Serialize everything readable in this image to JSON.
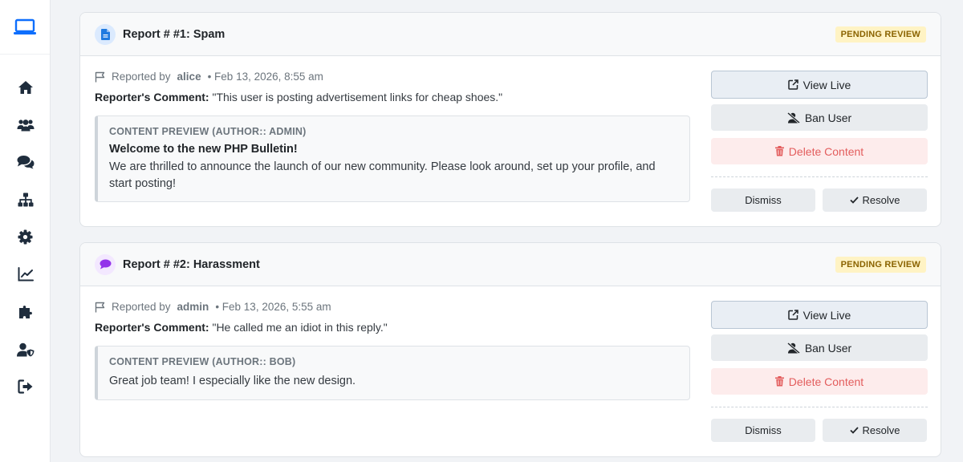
{
  "sidebar": {
    "items": [
      {
        "icon": "home-icon"
      },
      {
        "icon": "users-icon"
      },
      {
        "icon": "comments-icon"
      },
      {
        "icon": "sitemap-icon"
      },
      {
        "icon": "gear-icon"
      },
      {
        "icon": "chart-line-icon"
      },
      {
        "icon": "puzzle-icon"
      },
      {
        "icon": "user-shield-icon"
      },
      {
        "icon": "sign-out-icon"
      }
    ]
  },
  "colors": {
    "accent": "#0d6efd",
    "badge_bg": "#fff3c4",
    "badge_text": "#8a6300",
    "danger": "#e35d5d"
  },
  "reports": [
    {
      "title": "Report # #1: Spam",
      "icon": "document-icon",
      "status": "PENDING REVIEW",
      "reported_by_label": "Reported by",
      "reporter": "alice",
      "date": "• Feb 13, 2026, 8:55 am",
      "comment_label": "Reporter's Comment:",
      "comment": "\"This user is posting advertisement links for cheap shoes.\"",
      "preview_title": "CONTENT PREVIEW (AUTHOR:: ADMIN)",
      "preview_heading": "Welcome to the new PHP Bulletin!",
      "preview_text": "We are thrilled to announce the launch of our new community. Please look around, set up your profile, and start posting!"
    },
    {
      "title": "Report # #2: Harassment",
      "icon": "chat-bubble-icon",
      "status": "PENDING REVIEW",
      "reported_by_label": "Reported by",
      "reporter": "admin",
      "date": "• Feb 13, 2026, 5:55 am",
      "comment_label": "Reporter's Comment:",
      "comment": "\"He called me an idiot in this reply.\"",
      "preview_title": "CONTENT PREVIEW (AUTHOR:: BOB)",
      "preview_heading": "",
      "preview_text": "Great job team! I especially like the new design."
    }
  ],
  "actions": {
    "view_live": "View Live",
    "ban_user": "Ban User",
    "delete_content": "Delete Content",
    "dismiss": "Dismiss",
    "resolve": "Resolve"
  }
}
